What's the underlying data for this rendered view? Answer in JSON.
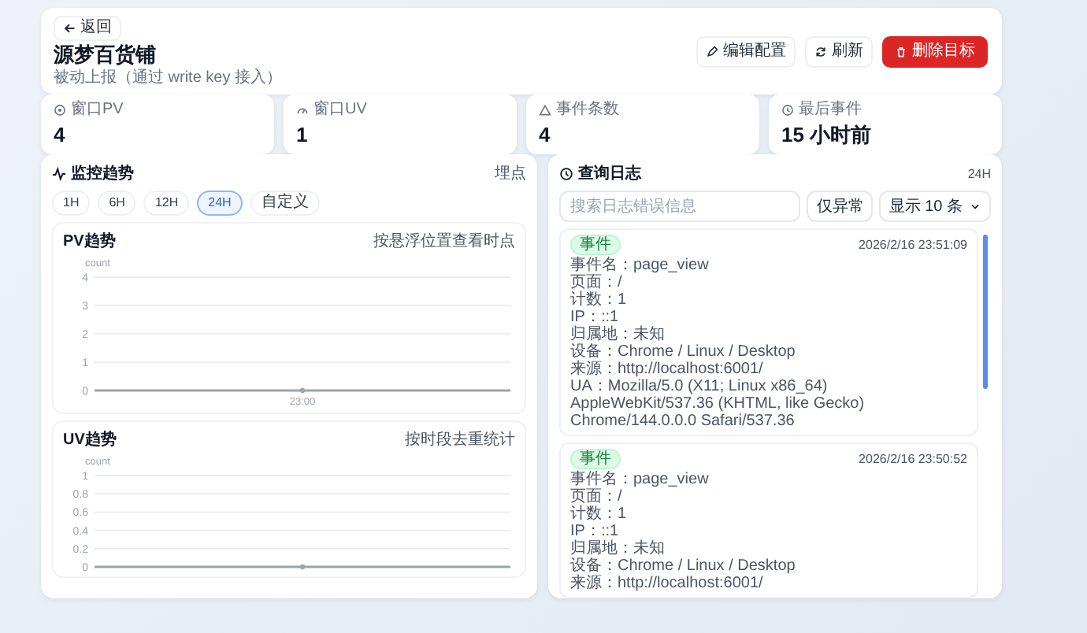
{
  "header": {
    "back_button": "返回",
    "title": "源梦百货铺",
    "subtitle": "被动上报（通过 write key 接入）",
    "actions": [
      {
        "kind": "edit",
        "label": "编辑配置"
      },
      {
        "kind": "refresh",
        "label": "刷新"
      },
      {
        "kind": "delete",
        "label": "删除目标"
      }
    ]
  },
  "stats": [
    {
      "kind": "pv",
      "label": "窗口PV",
      "value": "4"
    },
    {
      "kind": "uv",
      "label": "窗口UV",
      "value": "1"
    },
    {
      "kind": "events",
      "label": "事件条数",
      "value": "4"
    },
    {
      "kind": "last",
      "label": "最后事件",
      "value": "15 小时前"
    }
  ],
  "monitor": {
    "title": "监控趋势",
    "link": "埋点",
    "ranges": [
      {
        "label": "1H",
        "selected": false
      },
      {
        "label": "6H",
        "selected": false
      },
      {
        "label": "12H",
        "selected": false
      },
      {
        "label": "24H",
        "selected": true
      },
      {
        "label": "自定义",
        "selected": false
      }
    ],
    "charts": [
      {
        "title": "PV趋势",
        "hint": "按悬浮位置查看时点",
        "chart_data": {
          "type": "line",
          "ylabel": "count",
          "categories": [
            "23:00"
          ],
          "values": [
            0
          ],
          "ylim": [
            0,
            4
          ],
          "yticks": [
            0,
            1,
            2,
            3,
            4
          ],
          "grid": true,
          "marker": true
        }
      },
      {
        "title": "UV趋势",
        "hint": "按时段去重统计",
        "chart_data": {
          "type": "line",
          "ylabel": "count",
          "values": [
            0
          ],
          "ylim": [
            0,
            1
          ],
          "yticks": [
            0,
            0.2,
            0.4,
            0.6,
            0.8,
            1
          ],
          "grid": true,
          "marker": true
        }
      }
    ]
  },
  "logs": {
    "title": "查询日志",
    "range": "24H",
    "search": {
      "placeholder": "搜索日志错误信息"
    },
    "filter_button": "仅异常",
    "page_size": "显示 10 条",
    "entries": [
      {
        "tag": "事件",
        "time": "2026/2/16 23:51:09",
        "lines": [
          "事件名：page_view",
          "页面：/",
          "计数：1",
          "IP：::1",
          "归属地：未知",
          "设备：Chrome / Linux / Desktop",
          "来源：http://localhost:6001/",
          "UA：Mozilla/5.0 (X11; Linux x86_64) AppleWebKit/537.36 (KHTML, like Gecko) Chrome/144.0.0.0 Safari/537.36"
        ]
      },
      {
        "tag": "事件",
        "time": "2026/2/16 23:50:52",
        "lines": [
          "事件名：page_view",
          "页面：/",
          "计数：1",
          "IP：::1",
          "归属地：未知",
          "设备：Chrome / Linux / Desktop",
          "来源：http://localhost:6001/"
        ]
      }
    ]
  }
}
